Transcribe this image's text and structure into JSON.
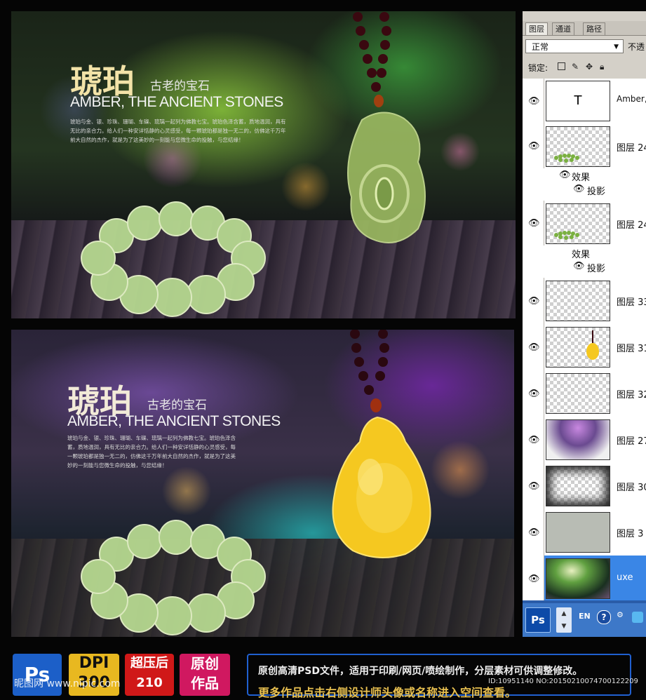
{
  "banners": [
    {
      "title_cn": "琥珀",
      "subtitle_cn": "古老的宝石",
      "title_en": "AMBER, THE ANCIENT STONES",
      "body": "琥珀与金、银、珍珠、珊瑚、车磲、琉璃一起列为佛教七宝。琥珀色泽含蓄，质地温润，具有无比的亲合力。给人们一种安详恬静的心灵感受，每一颗琥珀都是独一无二的，仿佛这千万年前大自然的杰作，就是为了这美妙的一刻能与您微生命的投触，与您结缘！"
    },
    {
      "title_cn": "琥珀",
      "subtitle_cn": "古老的宝石",
      "title_en": "AMBER, THE ANCIENT STONES",
      "body": "琥珀与金、银、珍珠、珊瑚、车磲、琉璃一起列为佛教七宝。琥珀色泽含蓄，质地温润，具有无比的亲合力。给人们一种安详恬静的心灵感受，每一颗琥珀都是独一无二的，仿佛这千万年前大自然的杰作，就是为了这美妙的一刻能与您微生命的投触，与您结缘！"
    }
  ],
  "layers_panel": {
    "tabs": [
      "图层",
      "通道",
      "路径"
    ],
    "blend_mode": "正常",
    "opacity_label": "不透",
    "lock_label": "锁定:",
    "lock_icons": [
      "lock-transparent-icon",
      "lock-paint-icon",
      "lock-move-icon",
      "lock-all-icon"
    ],
    "layers": [
      {
        "name": "Amber,",
        "thumb": "text"
      },
      {
        "name": "图层 24",
        "thumb": "beads",
        "effects_label": "效果",
        "effect": "投影"
      },
      {
        "name": "图层 24",
        "thumb": "beads",
        "effects_label": "效果",
        "effect": "投影"
      },
      {
        "name": "图层 33",
        "thumb": "empty"
      },
      {
        "name": "图层 31",
        "thumb": "pendant"
      },
      {
        "name": "图层 32",
        "thumb": "empty"
      },
      {
        "name": "图层 27",
        "thumb": "bokeh"
      },
      {
        "name": "图层 30",
        "thumb": "vignette"
      },
      {
        "name": "图层 3",
        "thumb": "gray"
      },
      {
        "name": "uxe",
        "thumb": "photo",
        "selected": true
      }
    ],
    "bottom_icons": [
      "link-icon",
      "fx-icon",
      "mask-icon"
    ]
  },
  "taskbar": {
    "app_button": "Ps",
    "lang": "EN",
    "help": "?"
  },
  "footer": {
    "badges": [
      {
        "text": "Ps",
        "color": "#1c5fc8"
      },
      {
        "text": "DPI\n300",
        "color": "#e8b820"
      },
      {
        "text": "超压后\n210",
        "color": "#d01818"
      },
      {
        "text": "原创\n作品",
        "color": "#d01860"
      }
    ],
    "line1": "原创高清PSD文件，适用于印刷/网页/喷绘制作，分层素材可供调整修改。",
    "line2": "更多作品点击右侧设计师头像或名称进入空间查看。",
    "watermark": "昵图网 www.nipic.com",
    "id_text": "ID:10951140 NO:20150210074700122209"
  }
}
